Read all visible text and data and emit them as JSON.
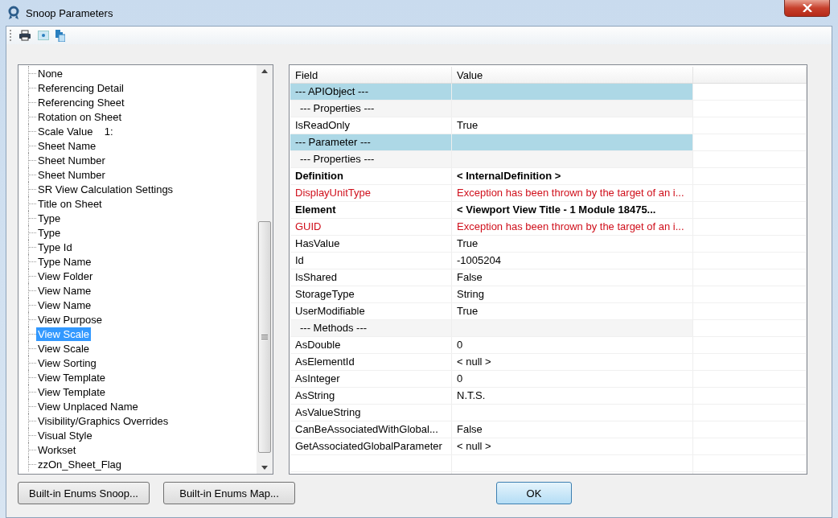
{
  "window": {
    "title": "Snoop Parameters"
  },
  "tree": {
    "items": [
      {
        "label": "None",
        "selected": false
      },
      {
        "label": "Referencing Detail",
        "selected": false
      },
      {
        "label": "Referencing Sheet",
        "selected": false
      },
      {
        "label": "Rotation on Sheet",
        "selected": false
      },
      {
        "label": "Scale Value    1:",
        "selected": false
      },
      {
        "label": "Sheet Name",
        "selected": false
      },
      {
        "label": "Sheet Number",
        "selected": false
      },
      {
        "label": "Sheet Number",
        "selected": false
      },
      {
        "label": "SR View Calculation Settings",
        "selected": false
      },
      {
        "label": "Title on Sheet",
        "selected": false
      },
      {
        "label": "Type",
        "selected": false
      },
      {
        "label": "Type",
        "selected": false
      },
      {
        "label": "Type Id",
        "selected": false
      },
      {
        "label": "Type Name",
        "selected": false
      },
      {
        "label": "View Folder",
        "selected": false
      },
      {
        "label": "View Name",
        "selected": false
      },
      {
        "label": "View Name",
        "selected": false
      },
      {
        "label": "View Purpose",
        "selected": false
      },
      {
        "label": "View Scale",
        "selected": true
      },
      {
        "label": "View Scale",
        "selected": false
      },
      {
        "label": "View Sorting",
        "selected": false
      },
      {
        "label": "View Template",
        "selected": false
      },
      {
        "label": "View Template",
        "selected": false
      },
      {
        "label": "View Unplaced Name",
        "selected": false
      },
      {
        "label": "Visibility/Graphics Overrides",
        "selected": false
      },
      {
        "label": "Visual Style",
        "selected": false
      },
      {
        "label": "Workset",
        "selected": false
      },
      {
        "label": "zzOn_Sheet_Flag",
        "selected": false
      }
    ]
  },
  "table": {
    "columns": [
      "Field",
      "Value"
    ],
    "rows": [
      {
        "kind": "section",
        "field": "--- APIObject ---"
      },
      {
        "kind": "subsection",
        "field": "--- Properties ---"
      },
      {
        "kind": "normal",
        "field": "IsReadOnly",
        "value": "True"
      },
      {
        "kind": "section",
        "field": "--- Parameter ---"
      },
      {
        "kind": "subsection",
        "field": "--- Properties ---"
      },
      {
        "kind": "bold",
        "field": "Definition",
        "value": "< InternalDefinition >"
      },
      {
        "kind": "error",
        "field": "DisplayUnitType",
        "value": "Exception has been thrown by the target of an i..."
      },
      {
        "kind": "bold",
        "field": "Element",
        "value": "< Viewport  View Title - 1 Module  18475..."
      },
      {
        "kind": "error",
        "field": "GUID",
        "value": "Exception has been thrown by the target of an i..."
      },
      {
        "kind": "normal",
        "field": "HasValue",
        "value": "True"
      },
      {
        "kind": "normal",
        "field": "Id",
        "value": "-1005204"
      },
      {
        "kind": "normal",
        "field": "IsShared",
        "value": "False"
      },
      {
        "kind": "normal",
        "field": "StorageType",
        "value": "String"
      },
      {
        "kind": "normal",
        "field": "UserModifiable",
        "value": "True"
      },
      {
        "kind": "subsection",
        "field": "--- Methods ---"
      },
      {
        "kind": "normal",
        "field": "AsDouble",
        "value": "0"
      },
      {
        "kind": "normal",
        "field": "AsElementId",
        "value": "< null >"
      },
      {
        "kind": "normal",
        "field": "AsInteger",
        "value": "0"
      },
      {
        "kind": "normal",
        "field": "AsString",
        "value": "N.T.S."
      },
      {
        "kind": "normal",
        "field": "AsValueString"
      },
      {
        "kind": "normal",
        "field": "CanBeAssociatedWithGlobal...",
        "value": "False"
      },
      {
        "kind": "normal",
        "field": "GetAssociatedGlobalParameter",
        "value": "< null >"
      }
    ]
  },
  "buttons": [
    "Built-in Enums Snoop...",
    "Built-in Enums Map...",
    "OK"
  ]
}
